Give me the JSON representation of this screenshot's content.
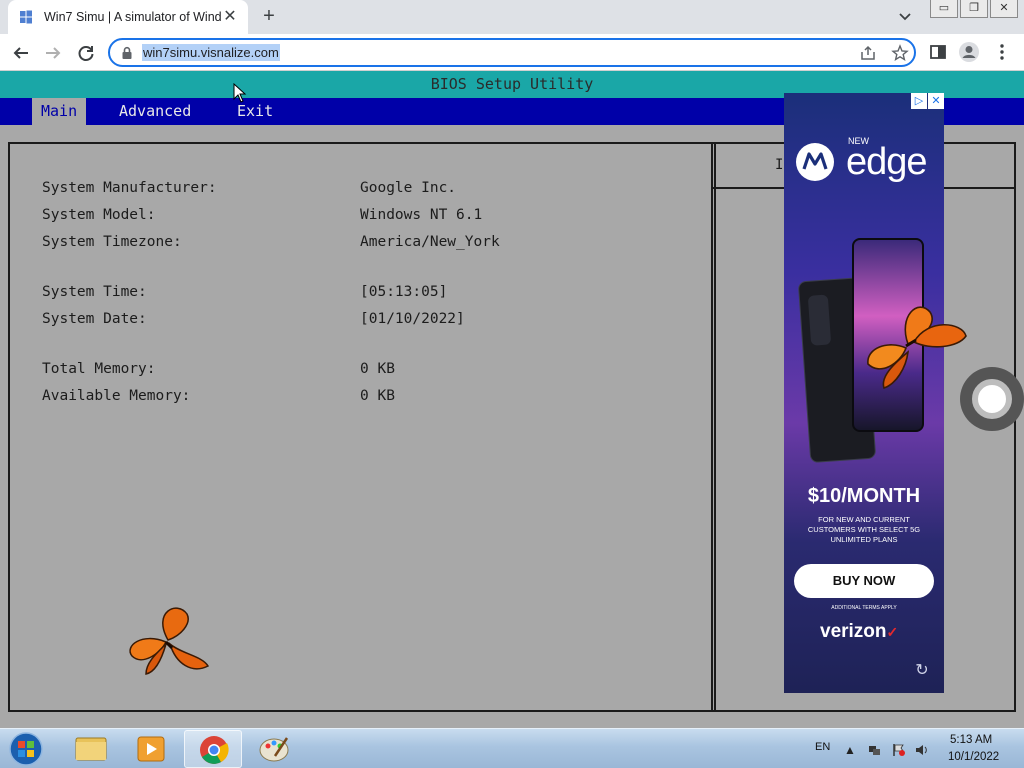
{
  "browser": {
    "tab_title": "Win7 Simu | A simulator of Wind",
    "tab_close": "✕",
    "new_tab": "+",
    "url": "win7simu.visnalize.com",
    "window_buttons": [
      "▭",
      "❐",
      "✕"
    ]
  },
  "bios": {
    "title": "BIOS Setup Utility",
    "menu": [
      "Main",
      "Advanced",
      "Exit"
    ],
    "active_menu": "Main",
    "side_header": "I                   p",
    "rows": [
      {
        "label": "System Manufacturer:",
        "value": "Google Inc."
      },
      {
        "label": "System Model:",
        "value": "Windows NT 6.1"
      },
      {
        "label": "System Timezone:",
        "value": "America/New_York"
      },
      {
        "label": "System Time:",
        "value": "[05:13:05]"
      },
      {
        "label": "System Date:",
        "value": "[01/10/2022]"
      },
      {
        "label": "Total Memory:",
        "value": "0 KB"
      },
      {
        "label": "Available Memory:",
        "value": "0 KB"
      }
    ]
  },
  "ad": {
    "choices": [
      "▷",
      "✕"
    ],
    "new": "NEW",
    "product": "edge",
    "price": "$10/MONTH",
    "fine_print": "FOR NEW AND CURRENT CUSTOMERS WITH SELECT 5G UNLIMITED PLANS",
    "cta": "BUY NOW",
    "terms": "ADDITIONAL TERMS APPLY",
    "brand": "verizon",
    "brand_mark": "✓",
    "replay": "↻",
    "colors": {
      "verizon_check": "#e3292d"
    }
  },
  "taskbar": {
    "language": "EN",
    "time": "5:13 AM",
    "date": "10/1/2022"
  }
}
